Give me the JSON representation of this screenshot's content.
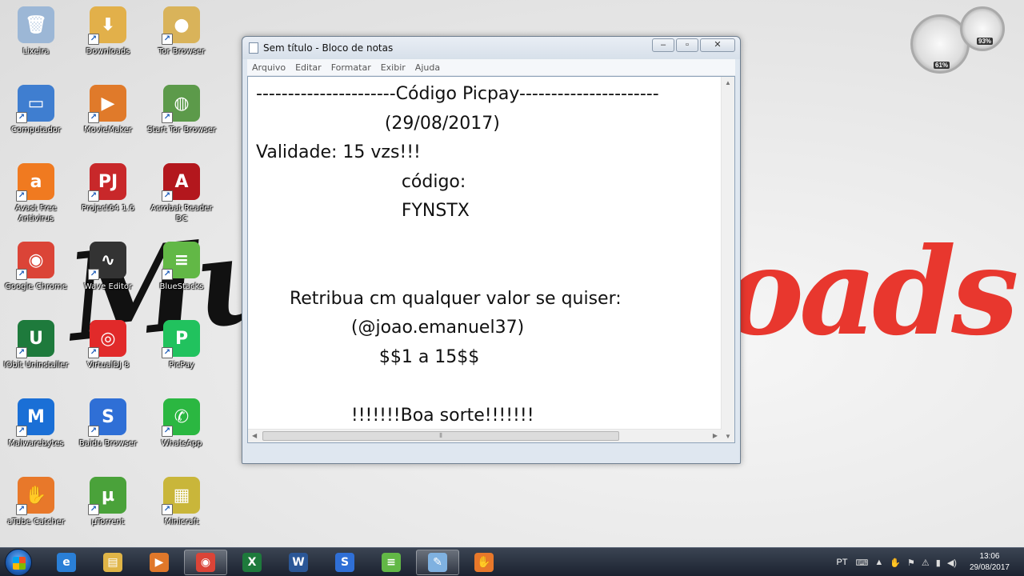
{
  "wallpaper": {
    "left_text": "Mu",
    "right_text": "oads"
  },
  "desktop_icons": [
    {
      "label": "Lixeira",
      "glyph": "🗑",
      "color": "#9cb7d6",
      "icon": "recycle-bin-icon"
    },
    {
      "label": "Downloads",
      "glyph": "⬇",
      "color": "#e2b04a",
      "icon": "downloads-folder-icon"
    },
    {
      "label": "Tor Browser",
      "glyph": "●",
      "color": "#d9b35a",
      "icon": "tor-browser-folder-icon"
    },
    {
      "label": "Computador",
      "glyph": "▭",
      "color": "#3f7ed0",
      "icon": "computer-icon"
    },
    {
      "label": "MovieMaker",
      "glyph": "▶",
      "color": "#e07a2a",
      "icon": "moviemaker-icon"
    },
    {
      "label": "Start Tor Browser",
      "glyph": "◍",
      "color": "#5c9a4a",
      "icon": "tor-globe-icon"
    },
    {
      "label": "Avast Free Antivirus",
      "glyph": "a",
      "color": "#f07a20",
      "icon": "avast-icon"
    },
    {
      "label": "Project64 1.6",
      "glyph": "PJ",
      "color": "#c8282a",
      "icon": "project64-icon"
    },
    {
      "label": "Acrobat Reader DC",
      "glyph": "A",
      "color": "#b3171d",
      "icon": "acrobat-icon"
    },
    {
      "label": "Google Chrome",
      "glyph": "◉",
      "color": "#db4437",
      "icon": "chrome-icon"
    },
    {
      "label": "Wave Editor",
      "glyph": "∿",
      "color": "#333333",
      "icon": "wave-editor-icon"
    },
    {
      "label": "BlueStacks",
      "glyph": "≡",
      "color": "#62b846",
      "icon": "bluestacks-icon"
    },
    {
      "label": "IObit Uninstaller",
      "glyph": "U",
      "color": "#1e7a3c",
      "icon": "iobit-icon"
    },
    {
      "label": "VirtualDJ 8",
      "glyph": "◎",
      "color": "#e12a2a",
      "icon": "virtualdj-icon"
    },
    {
      "label": "PicPay",
      "glyph": "P",
      "color": "#21c25e",
      "icon": "picpay-icon"
    },
    {
      "label": "Malwarebytes",
      "glyph": "M",
      "color": "#1a6fd6",
      "icon": "malwarebytes-icon"
    },
    {
      "label": "Baidu Browser",
      "glyph": "S",
      "color": "#2f6fd6",
      "icon": "baidu-browser-icon"
    },
    {
      "label": "WhatsApp",
      "glyph": "✆",
      "color": "#2bb741",
      "icon": "whatsapp-icon"
    },
    {
      "label": "aTube Catcher",
      "glyph": "✋",
      "color": "#e8782a",
      "icon": "atube-catcher-icon"
    },
    {
      "label": "µTorrent",
      "glyph": "µ",
      "color": "#4aa23a",
      "icon": "utorrent-icon"
    },
    {
      "label": "Minicraft",
      "glyph": "▦",
      "color": "#c9b63a",
      "icon": "minicraft-icon"
    }
  ],
  "gadget": {
    "cpu": "61%",
    "memory": "93%"
  },
  "notepad": {
    "title": "Sem título - Bloco de notas",
    "menu": [
      "Arquivo",
      "Editar",
      "Formatar",
      "Exibir",
      "Ajuda"
    ],
    "lines": [
      "----------------------Código Picpay----------------------",
      "                       (29/08/2017)",
      "Validade: 15 vzs!!!",
      "                          código:",
      "                          FYNSTX",
      "",
      "",
      "      Retribua cm qualquer valor se quiser:",
      "                 (@joao.emanuel37)",
      "                      $$1 a 15$$",
      "",
      "                 !!!!!!!Boa sorte!!!!!!!"
    ]
  },
  "taskbar": {
    "buttons": [
      {
        "icon": "internet-explorer-icon",
        "glyph": "e",
        "color": "#2a7fd6"
      },
      {
        "icon": "file-explorer-icon",
        "glyph": "▤",
        "color": "#e0b547"
      },
      {
        "icon": "media-player-icon",
        "glyph": "▶",
        "color": "#e0782a"
      },
      {
        "icon": "chrome-icon",
        "glyph": "◉",
        "color": "#db4437"
      },
      {
        "icon": "excel-icon",
        "glyph": "X",
        "color": "#1e7a3c"
      },
      {
        "icon": "word-icon",
        "glyph": "W",
        "color": "#2b5797"
      },
      {
        "icon": "baidu-browser-icon",
        "glyph": "S",
        "color": "#2f6fd6"
      },
      {
        "icon": "bluestacks-icon",
        "glyph": "≡",
        "color": "#62b846"
      },
      {
        "icon": "notepad-icon",
        "glyph": "✎",
        "color": "#7fb1e0"
      },
      {
        "icon": "atube-catcher-icon",
        "glyph": "✋",
        "color": "#e8782a"
      }
    ],
    "language": "PT",
    "time": "13:06",
    "date": "29/08/2017"
  }
}
